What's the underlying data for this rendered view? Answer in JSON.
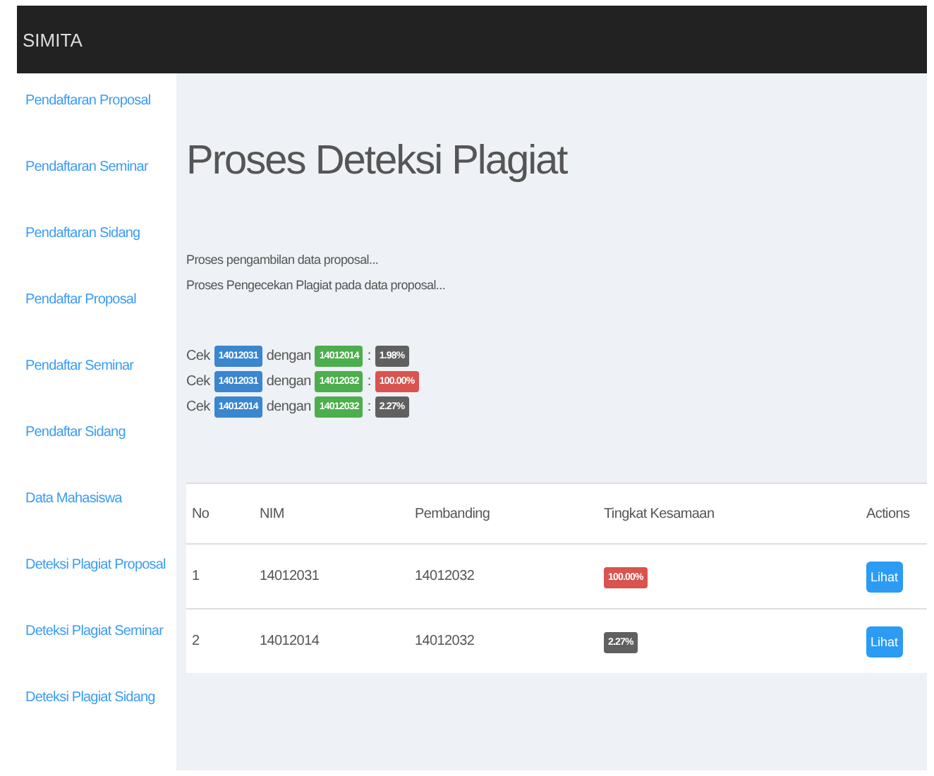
{
  "navbar": {
    "brand": "SIMITA"
  },
  "sidebar": {
    "items": [
      {
        "label": "Pendaftaran Proposal"
      },
      {
        "label": "Pendaftaran Seminar"
      },
      {
        "label": "Pendaftaran Sidang"
      },
      {
        "label": "Pendaftar Proposal"
      },
      {
        "label": "Pendaftar Seminar"
      },
      {
        "label": "Pendaftar Sidang"
      },
      {
        "label": "Data Mahasiswa"
      },
      {
        "label": "Deteksi Plagiat Proposal"
      },
      {
        "label": "Deteksi Plagiat Seminar"
      },
      {
        "label": "Deteksi Plagiat Sidang"
      }
    ]
  },
  "title": "Proses Deteksi Plagiat",
  "log": [
    "Proses pengambilan data proposal...",
    "Proses Pengecekan Plagiat pada data proposal..."
  ],
  "checks": [
    {
      "prefix": "Cek",
      "nim": "14012031",
      "middle": "dengan",
      "compare": "14012014",
      "sep": ":",
      "result": "1.98%",
      "color": "#606060"
    },
    {
      "prefix": "Cek",
      "nim": "14012031",
      "middle": "dengan",
      "compare": "14012032",
      "sep": ":",
      "result": "100.00%",
      "color": "#d9534f"
    },
    {
      "prefix": "Cek",
      "nim": "14012014",
      "middle": "dengan",
      "compare": "14012032",
      "sep": ":",
      "result": "2.27%",
      "color": "#606060"
    }
  ],
  "table": {
    "columns": [
      "No",
      "NIM",
      "Pembanding",
      "Tingkat Kesamaan",
      "Actions"
    ],
    "rows": [
      {
        "no": "1",
        "nim": "14012031",
        "compare": "14012032",
        "similarity": "100.00%",
        "color": "#d9534f",
        "action": "Lihat"
      },
      {
        "no": "2",
        "nim": "14012014",
        "compare": "14012032",
        "similarity": "2.27%",
        "color": "#606060",
        "action": "Lihat"
      }
    ]
  }
}
